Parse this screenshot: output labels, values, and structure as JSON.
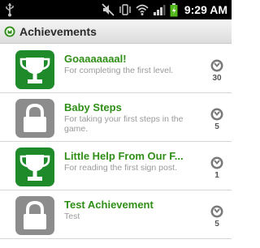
{
  "status_bar": {
    "time": "9:29 AM",
    "icons": [
      "usb-icon",
      "mute-icon",
      "vibrate-icon",
      "wifi-icon",
      "signal-icon",
      "battery-icon"
    ]
  },
  "header": {
    "title": "Achievements",
    "icon": "achievement-badge-icon"
  },
  "achievements": [
    {
      "name": "Goaaaaaaal!",
      "description": "For completing the first level.",
      "points": "30",
      "unlocked": true,
      "icon": "trophy-icon"
    },
    {
      "name": "Baby Steps",
      "description": "For taking your first steps in the game.",
      "points": "5",
      "unlocked": false,
      "icon": "lock-icon"
    },
    {
      "name": "Little Help From Our F...",
      "description": "For reading the first sign post.",
      "points": "1",
      "unlocked": true,
      "icon": "trophy-icon"
    },
    {
      "name": "Test Achievement",
      "description": "Test",
      "points": "5",
      "unlocked": false,
      "icon": "lock-icon"
    }
  ],
  "colors": {
    "unlocked_badge": "#1f8a2a",
    "locked_badge": "#8c8c8c",
    "name_text": "#2f8f16",
    "status_bar": "#000000"
  }
}
